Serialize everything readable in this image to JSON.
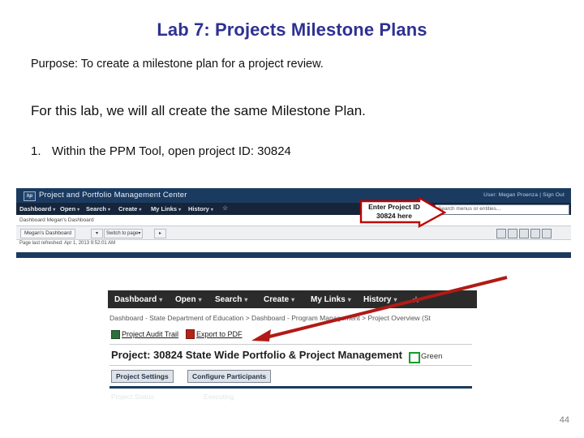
{
  "slide": {
    "title": "Lab 7: Projects Milestone Plans",
    "purpose": "Purpose:  To create a milestone plan for a project review.",
    "lab_statement": "For this lab, we will all create the same Milestone Plan.",
    "step_number": "1.",
    "step_text": "Within the PPM Tool, open project ID:  30824",
    "page_number": "44",
    "title_color": "#2e3192"
  },
  "callout": {
    "line1": "Enter Project ID",
    "line2": "30824 here",
    "border_color": "#c00000"
  },
  "dashboard_screenshot": {
    "logo": "hp",
    "banner_title": "Project and Portfolio Management Center",
    "user_info": "User: Megan Proenza  |  Sign Out",
    "menu": [
      {
        "label": "Dashboard",
        "caret": "▾"
      },
      {
        "label": "Open",
        "caret": "▾"
      },
      {
        "label": "Search",
        "caret": "▾"
      },
      {
        "label": "Create",
        "caret": "▾"
      },
      {
        "label": "My Links",
        "caret": "▾"
      },
      {
        "label": "History",
        "caret": "▾"
      }
    ],
    "favorites_icon": "☆",
    "search_placeholder": "Search menus or entities...",
    "breadcrumb": "Dashboard   Megan's Dashboard",
    "tab_label": "Megan's Dashboard",
    "tab_dropdown": "▾",
    "switch_to_page_label": "Switch to page",
    "switch_to_page_caret": "▾",
    "next_page_arrow": "▸",
    "toolbar_icons": [
      "collapse-icon",
      "print-icon",
      "export-icon",
      "save-icon",
      "personalize-icon"
    ],
    "refresh_text": "Page last refreshed: Apr 1, 2013 9:52:01 AM"
  },
  "project_overview_screenshot": {
    "menu": [
      {
        "label": "Dashboard",
        "caret": "▾"
      },
      {
        "label": "Open",
        "caret": "▾"
      },
      {
        "label": "Search",
        "caret": "▾"
      },
      {
        "label": "Create",
        "caret": "▾"
      },
      {
        "label": "My Links",
        "caret": "▾"
      },
      {
        "label": "History",
        "caret": "▾"
      }
    ],
    "favorites_icon": "☆",
    "breadcrumb": "Dashboard - State Department of Education > Dashboard - Program Management > Project Overview (St",
    "audit_link": "Project Audit Trail",
    "pdf_link": "Export to PDF",
    "project_title": "Project: 30824 State Wide Portfolio & Project Management",
    "status_label": "Green",
    "status_color": "#179c29",
    "buttons": [
      {
        "label": "Project Settings"
      },
      {
        "label": "Configure Participants"
      }
    ],
    "faded_row_left": "Project Status",
    "faded_row_right": "Executing"
  }
}
